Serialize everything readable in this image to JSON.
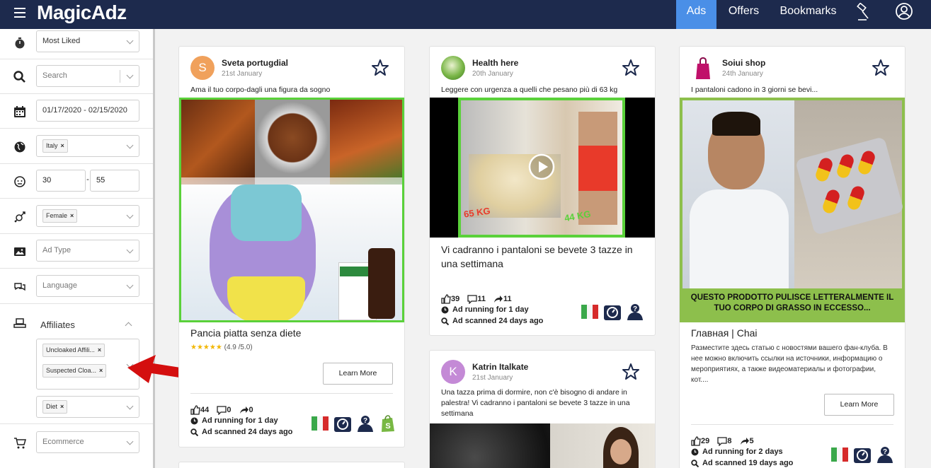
{
  "header": {
    "logo": "MagicAdz",
    "nav": {
      "ads": "Ads",
      "offers": "Offers",
      "bookmarks": "Bookmarks"
    }
  },
  "sidebar": {
    "sort": "Most Liked",
    "search_placeholder": "Search",
    "date_range": "01/17/2020 - 02/15/2020",
    "country_tag": "Italy",
    "age_min": "30",
    "age_sep": "-",
    "age_max": "55",
    "gender_tag": "Female",
    "ad_type_placeholder": "Ad Type",
    "language_placeholder": "Language",
    "affiliates_label": "Affiliates",
    "affiliate_tags": [
      "Uncloaked Affili...",
      "Suspected Cloa..."
    ],
    "niche_tag": "Diet",
    "ecommerce_placeholder": "Ecommerce"
  },
  "cards": [
    {
      "avatar_letter": "S",
      "avatar_color": "#f0a15c",
      "page_name": "Sveta portugdial",
      "date": "21st January",
      "caption": "Ama il tuo corpo-dagli una figura da sogno",
      "headline": "Pancia piatta senza diete",
      "rating_stars": "★★★★★",
      "rating_text": "(4.9 /5.0)",
      "cta": "Learn More",
      "likes": "44",
      "comments": "0",
      "shares": "0",
      "running": "Ad running for 1 day",
      "scanned": "Ad scanned 24 days ago"
    },
    {
      "avatar_color": "#7ab648",
      "page_name": "Health here",
      "date": "20th January",
      "caption": "Leggere con urgenza a quelli che pesano più di 63 kg",
      "video_label_left": "65 KG",
      "video_label_right": "44 KG",
      "headline": "Vi cadranno i pantaloni se bevete 3 tazze in una settimana",
      "likes": "39",
      "comments": "11",
      "shares": "11",
      "running": "Ad running for 1 day",
      "scanned": "Ad scanned 24 days ago"
    },
    {
      "avatar_letter": "K",
      "avatar_color": "#c48ad6",
      "page_name": "Katrin Italkate",
      "date": "21st January",
      "caption": "Una tazza prima di dormire, non c'è bisogno di andare in palestra! Vi cadranno i pantaloni se bevete 3 tazze in una settimana"
    },
    {
      "page_name": "Soiui shop",
      "date": "24th January",
      "caption": "I pantaloni cadono in 3 giorni se bevi...",
      "image_banner": "QUESTO PRODOTTO PULISCE LETTERALMENTE IL TUO CORPO DI GRASSO IN ECCESSO...",
      "headline": "Главная | Chai",
      "body": "Разместите здесь статью с новостями вашего фан-клуба. В нее можно включить ссылки на источники, информацию о мероприятиях, а также видеоматериалы и фотографии, кот....",
      "cta": "Learn More",
      "likes": "29",
      "comments": "8",
      "shares": "5",
      "running": "Ad running for 2 days",
      "scanned": "Ad scanned 19 days ago"
    }
  ],
  "colors": {
    "topbar": "#1d2a4d",
    "active_tab": "#4a8fe7",
    "ad_border_green": "#5ad13a",
    "arrow_red": "#d40f0f"
  }
}
